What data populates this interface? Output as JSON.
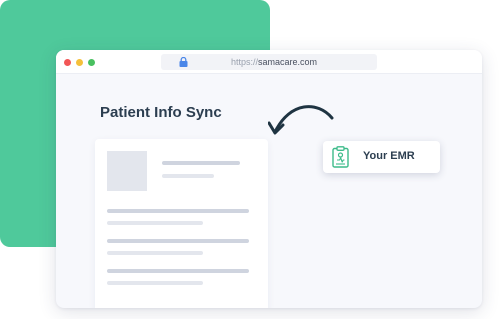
{
  "browser": {
    "url_protocol": "https://",
    "url_host": "samacare.com"
  },
  "page": {
    "title": "Patient Info Sync"
  },
  "emr_card": {
    "label": "Your EMR"
  },
  "colors": {
    "brand_green": "#4fc99b",
    "title_text": "#2c3e50",
    "placeholder_dark": "#cfd4df",
    "placeholder_light": "#e3e6ed",
    "arrow": "#1f3442"
  },
  "icons": [
    "lock-icon",
    "clipboard-icon",
    "curved-arrow-icon"
  ]
}
